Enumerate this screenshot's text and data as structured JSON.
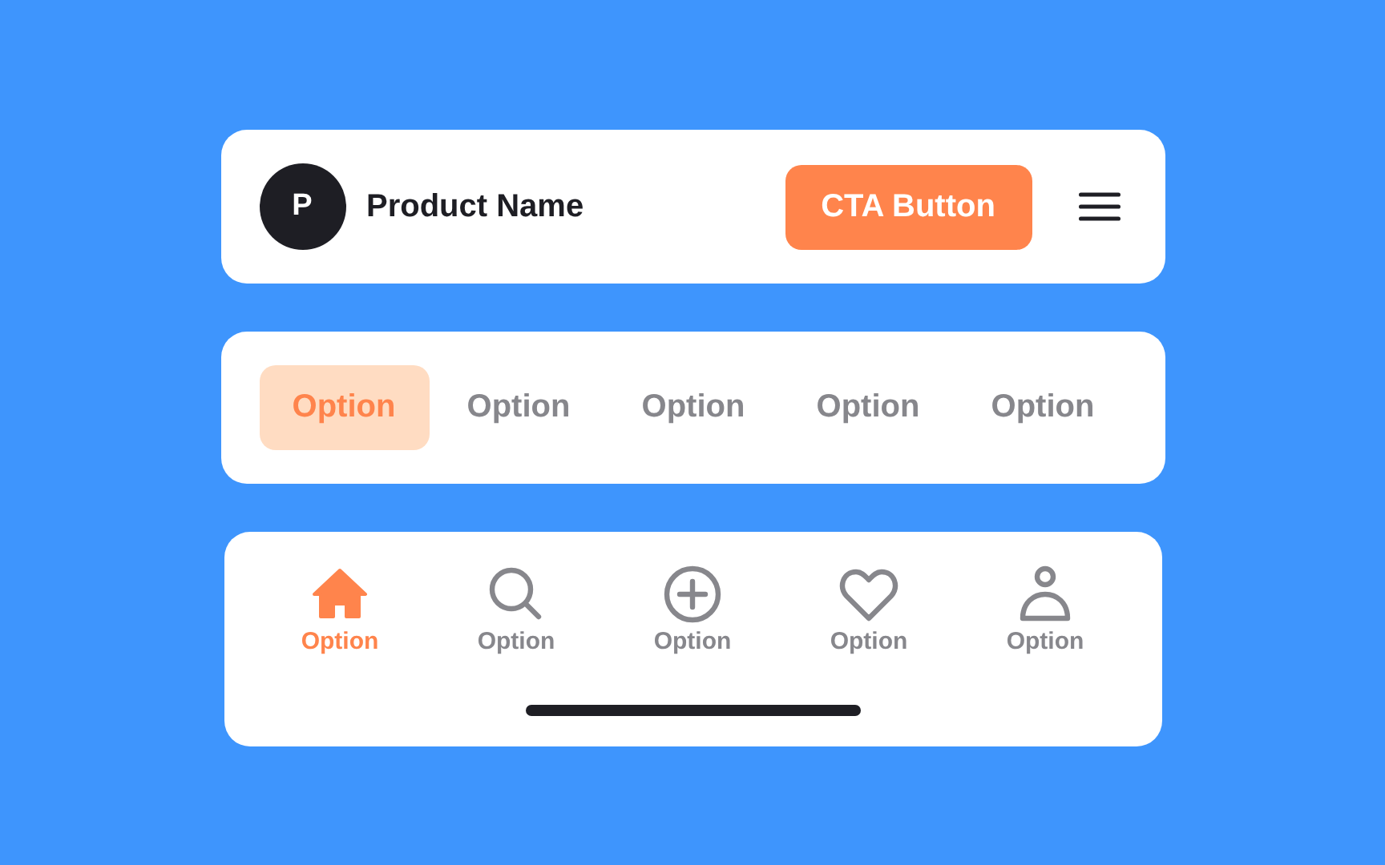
{
  "header": {
    "avatar_letter": "P",
    "product_name": "Product Name",
    "cta": "CTA Button"
  },
  "segments": [
    {
      "label": "Option",
      "selected": true
    },
    {
      "label": "Option",
      "selected": false
    },
    {
      "label": "Option",
      "selected": false
    },
    {
      "label": "Option",
      "selected": false
    },
    {
      "label": "Option",
      "selected": false
    }
  ],
  "tab_bar": [
    {
      "kind": "home",
      "label": "Option",
      "selected": true
    },
    {
      "kind": "search",
      "label": "Option",
      "selected": false
    },
    {
      "kind": "add",
      "label": "Option",
      "selected": false
    },
    {
      "kind": "heart",
      "label": "Option",
      "selected": false
    },
    {
      "kind": "person",
      "label": "Option",
      "selected": false
    }
  ]
}
